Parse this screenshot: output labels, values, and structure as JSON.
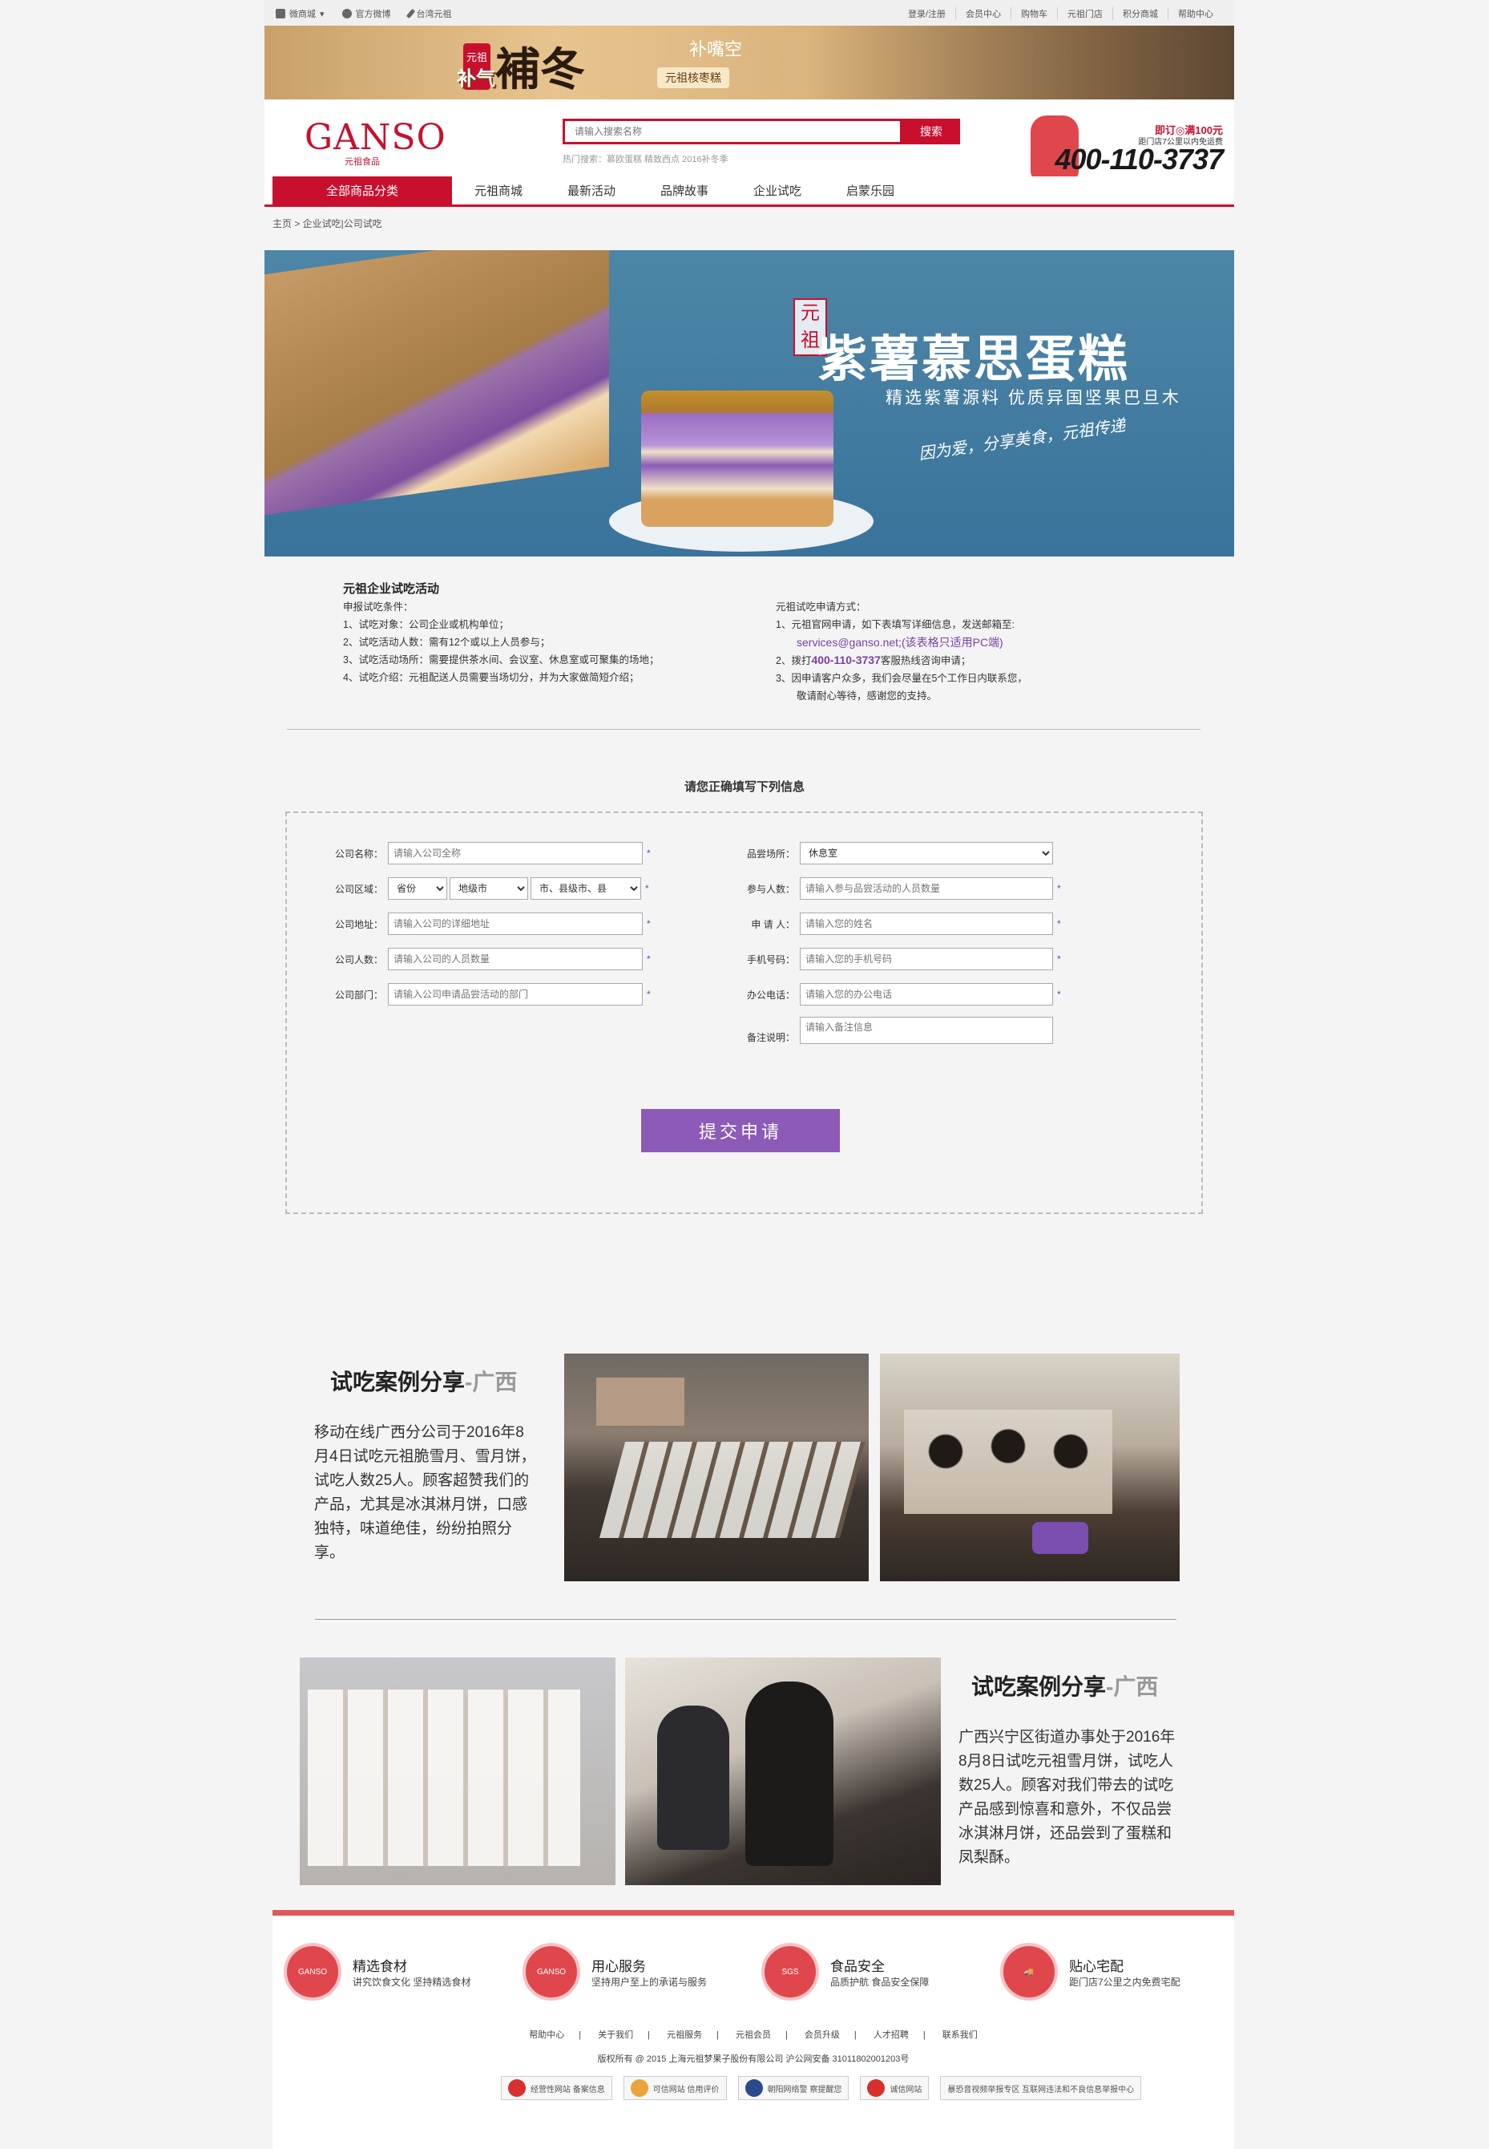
{
  "topbar": {
    "left": [
      "微商城",
      "官方微博",
      "台湾元祖"
    ],
    "right": [
      "登录/注册",
      "会员中心",
      "购物车",
      "元祖门店",
      "积分商城",
      "帮助中心"
    ]
  },
  "promo": {
    "seal": "元祖",
    "left": "补气",
    "main": "補冬",
    "right": "补嘴空",
    "tag": "元祖核枣糕"
  },
  "header": {
    "logo": "GANSO",
    "logo_sub": "元祖食品",
    "search_placeholder": "请输入搜索名称",
    "search_button": "搜索",
    "hot_label": "热门搜索：",
    "hot_terms": "慕欧蛋糕  精致西点  2016补冬季",
    "phone_promo": "即订◎满100元",
    "phone_promo2": "距门店7公里以内免运费",
    "phone": "400-110-3737"
  },
  "nav": {
    "all": "全部商品分类",
    "items": [
      "元祖商城",
      "最新活动",
      "品牌故事",
      "企业试吃",
      "启蒙乐园"
    ]
  },
  "breadcrumb": "主页 > 企业试吃|公司试吃",
  "hero": {
    "seal": "元祖",
    "title": "紫薯慕思蛋糕",
    "sub": "精选紫薯源料  优质异国坚果巴旦木",
    "slogan": "因为爱，分享美食，元祖传递"
  },
  "info": {
    "title": "元祖企业试吃活动",
    "cond_label": "申报试吃条件：",
    "c1": "1、试吃对象：公司企业或机构单位；",
    "c2": "2、试吃活动人数：需有12个或以上人员参与；",
    "c3": "3、试吃活动场所：需要提供茶水间、会议室、休息室或可聚集的场地；",
    "c4": "4、试吃介绍：元祖配送人员需要当场切分，并为大家做简短介绍；",
    "apply_label": "元祖试吃申请方式：",
    "a1": "1、元祖官网申请，如下表填写详细信息，发送邮箱至:",
    "a1_mail": "services@ganso.net;(该表格只适用PC端)",
    "a2_pre": "2、拨打",
    "a2_tel": "400-110-3737",
    "a2_post": "客服热线咨询申请；",
    "a3": "3、因申请客户众多，我们会尽量在5个工作日内联系您，",
    "a3b": "敬请耐心等待，感谢您的支持。"
  },
  "form": {
    "title": "请您正确填写下列信息",
    "company_name": "公司名称：",
    "company_name_ph": "请输入公司全称",
    "region": "公司区域：",
    "province": "省份",
    "city": "地级市",
    "county": "市、县级市、县",
    "address": "公司地址：",
    "address_ph": "请输入公司的详细地址",
    "people": "公司人数：",
    "people_ph": "请输入公司的人员数量",
    "dept": "公司部门：",
    "dept_ph": "请输入公司申请品尝活动的部门",
    "venue": "品尝场所：",
    "venue_val": "休息室",
    "joiners": "参与人数：",
    "joiners_ph": "请输入参与品尝活动的人员数量",
    "applicant": "申 请 人：",
    "applicant_ph": "请输入您的姓名",
    "mobile": "手机号码：",
    "mobile_ph": "请输入您的手机号码",
    "office": "办公电话：",
    "office_ph": "请输入您的办公电话",
    "remark": "备注说明：",
    "remark_ph": "请输入备注信息",
    "star": "*",
    "submit": "提交申请"
  },
  "cases": [
    {
      "title": "试吃案例分享",
      "region": "-广西",
      "text": "移动在线广西分公司于2016年8月4日试吃元祖脆雪月、雪月饼，试吃人数25人。顾客超赞我们的产品，尤其是冰淇淋月饼，口感独特，味道绝佳，纷纷拍照分享。"
    },
    {
      "title": "试吃案例分享",
      "region": "-广西",
      "text": "广西兴宁区街道办事处于2016年8月8日试吃元祖雪月饼，试吃人数25人。顾客对我们带去的试吃产品感到惊喜和意外，不仅品尝冰淇淋月饼，还品尝到了蛋糕和凤梨酥。"
    }
  ],
  "footer": {
    "features": [
      {
        "title": "精选食材",
        "desc": "讲究饮食文化 坚持精选食材",
        "icon": "GANSO"
      },
      {
        "title": "用心服务",
        "desc": "坚持用户至上的承诺与服务",
        "icon": "GANSO"
      },
      {
        "title": "食品安全",
        "desc": "品质护航  食品安全保障",
        "icon": "SGS"
      },
      {
        "title": "贴心宅配",
        "desc": "距门店7公里之内免费宅配",
        "icon": "truck"
      }
    ],
    "links": [
      "帮助中心",
      "|",
      "关于我们",
      "|",
      "元祖服务",
      "|",
      "元祖会员",
      "|",
      "会员升级",
      "|",
      "人才招聘",
      "|",
      "联系我们"
    ],
    "copyright": "版权所有 @ 2015 上海元祖梦果子股份有限公司 沪公网安备 31011802001203号",
    "badges": [
      "经营性网站 备案信息",
      "可信网站 信用评价",
      "朝阳网络警 察提醒您",
      "诚信网站",
      "暴恐音视频举报专区 互联网违法和不良信息举报中心"
    ]
  }
}
